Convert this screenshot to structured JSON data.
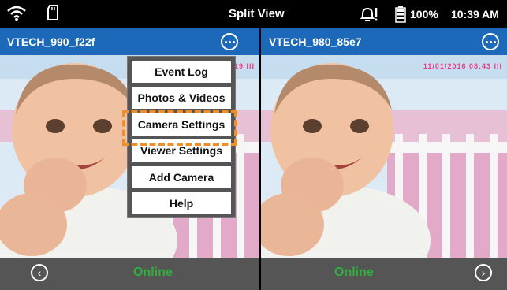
{
  "status_bar": {
    "title": "Split View",
    "battery": "100%",
    "time": "10:39 AM",
    "icons": [
      "wifi-icon",
      "sd-card-icon",
      "alert-icon",
      "battery-icon"
    ]
  },
  "left_panel": {
    "camera_name": "VTECH_990_f22f",
    "timestamp": "19 III",
    "status": "Online",
    "nav_icon": "chevron-left-icon"
  },
  "right_panel": {
    "camera_name": "VTECH_980_85e7",
    "timestamp": "11/01/2016 08:43 III",
    "status": "Online",
    "nav_icon": "chevron-right-icon"
  },
  "menu": {
    "items": [
      "Event Log",
      "Photos & Videos",
      "Camera Settings",
      "Viewer Settings",
      "Add Camera",
      "Help"
    ],
    "highlighted": "Camera Settings"
  },
  "colors": {
    "header_blue": "#1b69b8",
    "online_green": "#2fb03e",
    "highlight_orange": "#f08e2a",
    "footer_gray": "#555555"
  }
}
